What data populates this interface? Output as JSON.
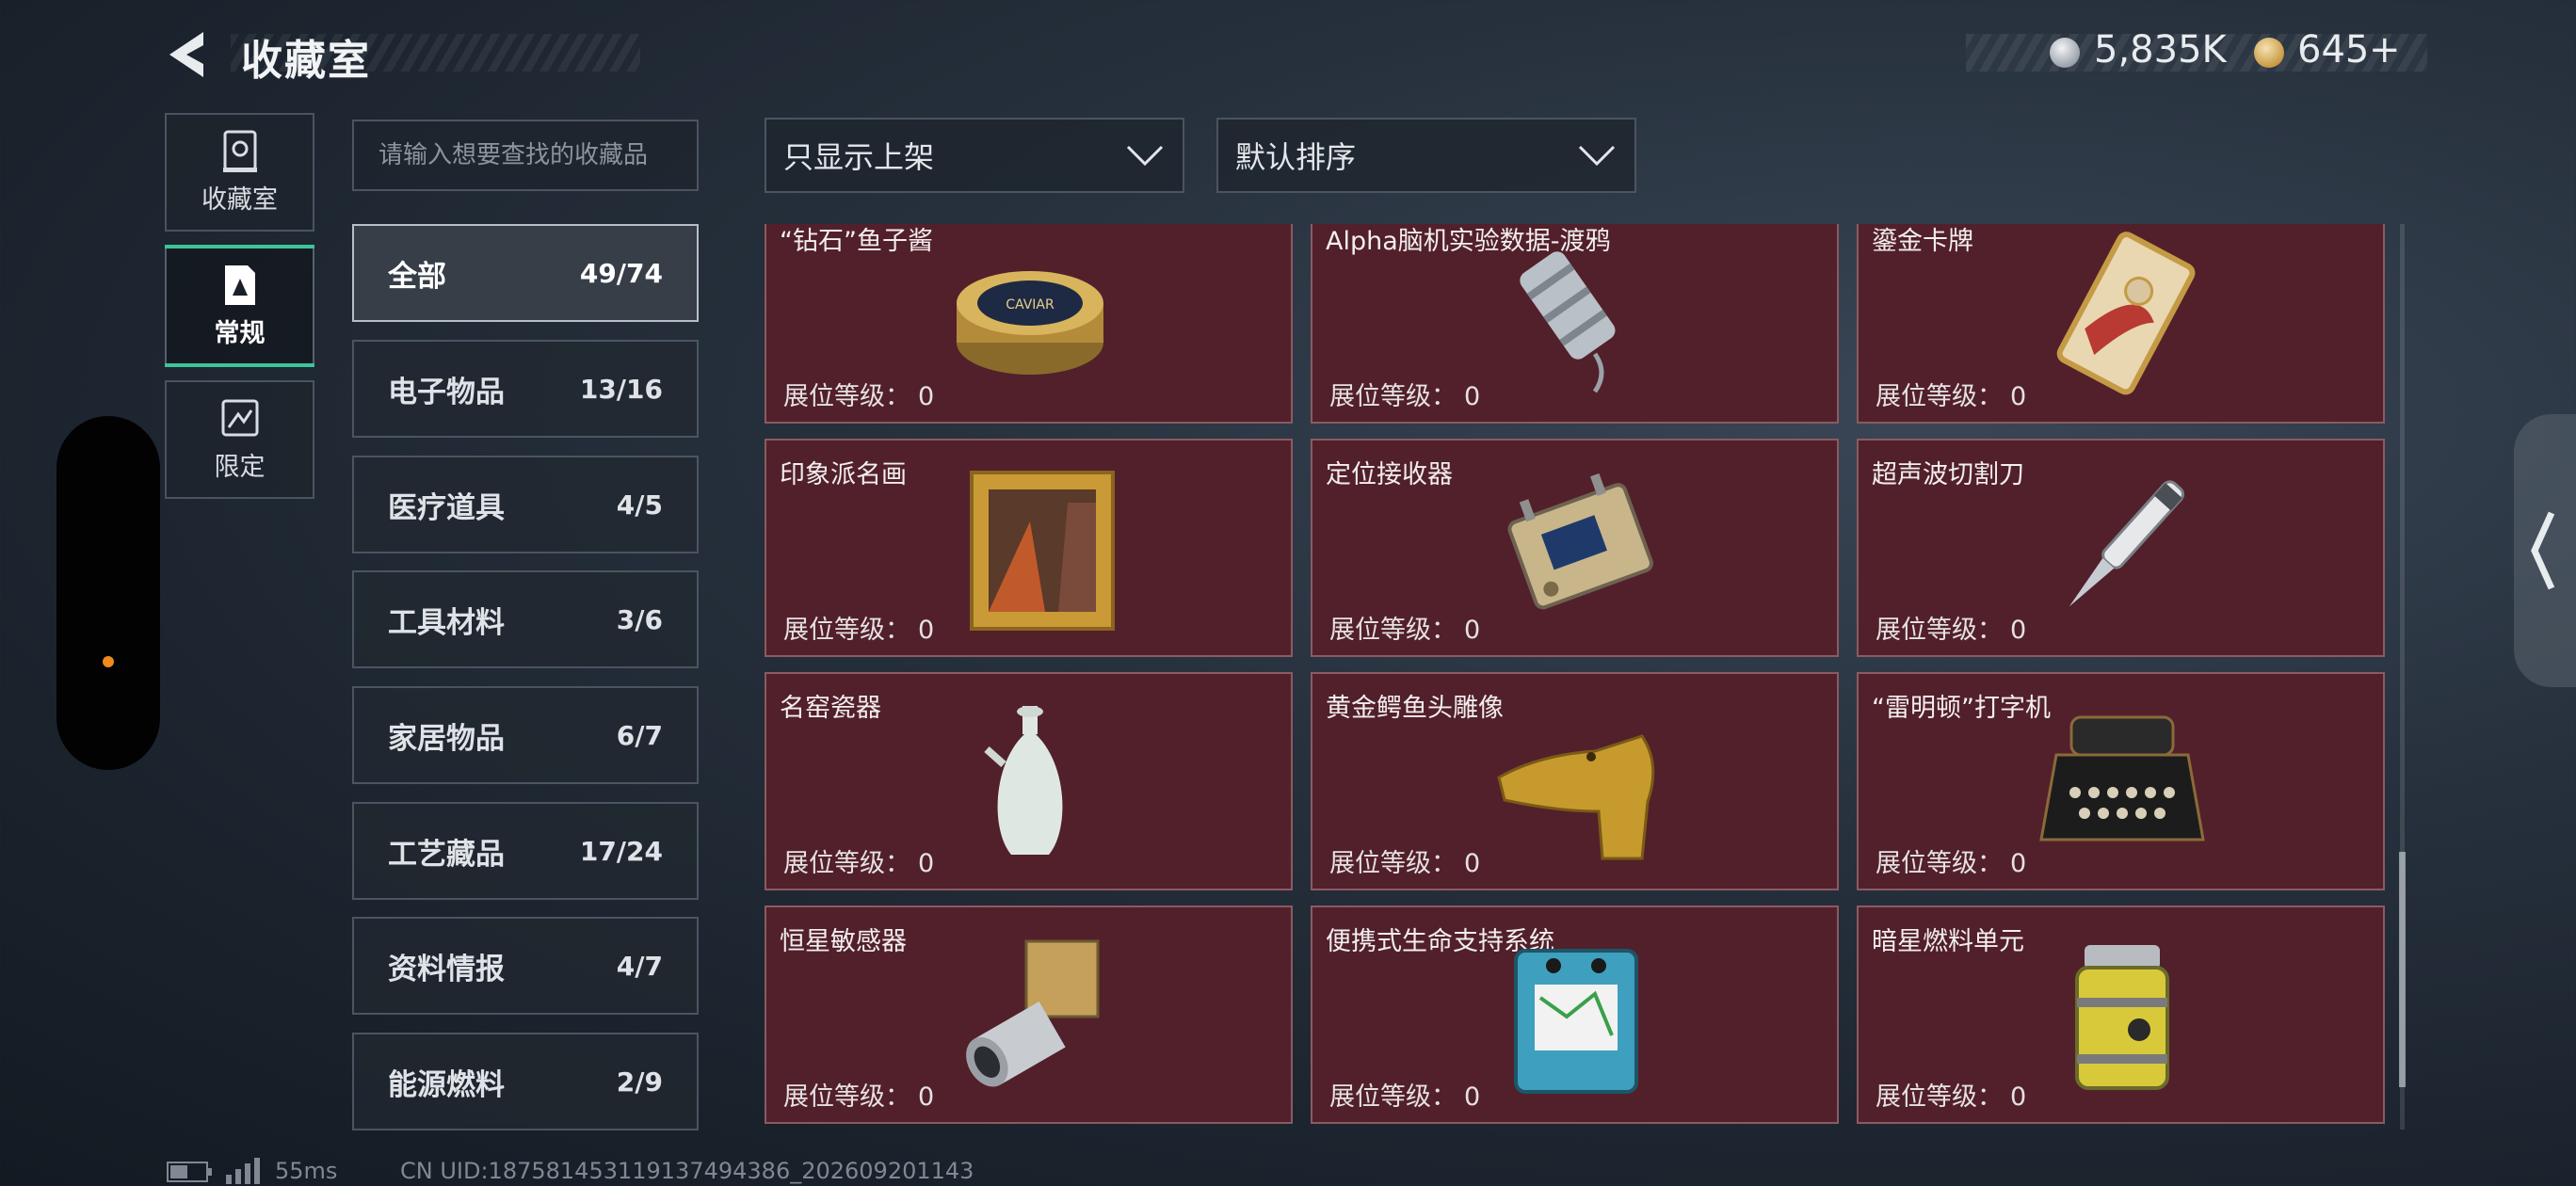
{
  "header": {
    "title": "收藏室",
    "currencies": [
      {
        "icon": "silver-coin-icon",
        "amount": "5,835K"
      },
      {
        "icon": "gold-coin-icon",
        "amount": "645",
        "add_label": "+"
      }
    ]
  },
  "nav": {
    "tabs": [
      {
        "icon": "trophy-case-icon",
        "label": "收藏室"
      },
      {
        "icon": "regular-collection-icon",
        "label": "常规",
        "active": true
      },
      {
        "icon": "limited-collection-icon",
        "label": "限定"
      }
    ]
  },
  "search": {
    "placeholder": "请输入想要查找的收藏品",
    "value": ""
  },
  "filters": {
    "shelf_filter": "只显示上架",
    "sort": "默认排序"
  },
  "categories": [
    {
      "name": "全部",
      "count": "49/74",
      "active": true
    },
    {
      "name": "电子物品",
      "count": "13/16"
    },
    {
      "name": "医疗道具",
      "count": "4/5"
    },
    {
      "name": "工具材料",
      "count": "3/6"
    },
    {
      "name": "家居物品",
      "count": "6/7"
    },
    {
      "name": "工艺藏品",
      "count": "17/24"
    },
    {
      "name": "资料情报",
      "count": "4/7"
    },
    {
      "name": "能源燃料",
      "count": "2/9"
    }
  ],
  "level_label": "展位等级：",
  "items": [
    {
      "name": "“钻石”鱼子酱",
      "level": "0",
      "icon": "caviar-tin-icon"
    },
    {
      "name": "Alpha脑机实验数据-渡鸦",
      "level": "0",
      "icon": "data-cylinder-icon"
    },
    {
      "name": "鎏金卡牌",
      "level": "0",
      "icon": "gilded-card-icon"
    },
    {
      "name": "印象派名画",
      "level": "0",
      "icon": "framed-painting-icon"
    },
    {
      "name": "定位接收器",
      "level": "0",
      "icon": "gps-receiver-icon"
    },
    {
      "name": "超声波切割刀",
      "level": "0",
      "icon": "ultrasonic-knife-icon"
    },
    {
      "name": "名窑瓷器",
      "level": "0",
      "icon": "porcelain-vase-icon"
    },
    {
      "name": "黄金鳄鱼头雕像",
      "level": "0",
      "icon": "golden-crocodile-statue-icon"
    },
    {
      "name": "“雷明顿”打字机",
      "level": "0",
      "icon": "typewriter-icon"
    },
    {
      "name": "恒星敏感器",
      "level": "0",
      "icon": "star-sensor-icon"
    },
    {
      "name": "便携式生命支持系统",
      "level": "0",
      "icon": "life-support-icon"
    },
    {
      "name": "暗星燃料单元",
      "level": "0",
      "icon": "fuel-cell-icon"
    }
  ],
  "footer": {
    "ping": "55ms",
    "uid": "CN UID:1875814531191374943​86_202609201143"
  },
  "colors": {
    "card_bg": "#52202a",
    "accent": "#3ec39a",
    "indicator_dot": "#f08a1d"
  }
}
